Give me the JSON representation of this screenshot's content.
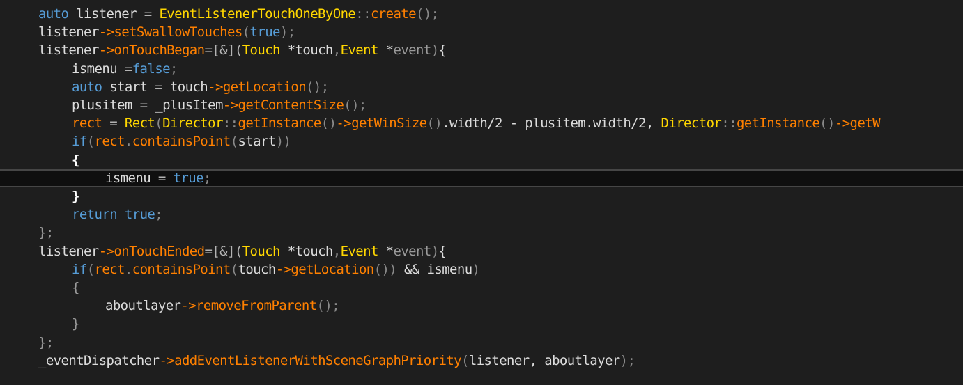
{
  "editor": {
    "theme": {
      "background": "#1e1e1e",
      "current_line_background": "#0f0f0f",
      "keyword_color": "#569cd6",
      "function_color": "#ff8000",
      "type_color": "#ffd700",
      "identifier_color": "#dcdcdc",
      "punctuation_color": "#8a8a8a"
    },
    "lines": [
      {
        "indent": 1,
        "tokens": [
          [
            "kw",
            "auto"
          ],
          [
            "id",
            " listener "
          ],
          [
            "op",
            "="
          ],
          [
            "id",
            " "
          ],
          [
            "type",
            "EventListenerTouchOneByOne"
          ],
          [
            "punc",
            "::"
          ],
          [
            "fn",
            "create"
          ],
          [
            "punc",
            "();"
          ]
        ]
      },
      {
        "indent": 1,
        "tokens": [
          [
            "id",
            "listener"
          ],
          [
            "fn",
            "->"
          ],
          [
            "fn",
            "setSwallowTouches"
          ],
          [
            "punc",
            "("
          ],
          [
            "kw",
            "true"
          ],
          [
            "punc",
            ");"
          ]
        ]
      },
      {
        "indent": 1,
        "tokens": [
          [
            "id",
            "listener"
          ],
          [
            "fn",
            "->"
          ],
          [
            "fn",
            "onTouchBegan"
          ],
          [
            "op",
            "=[&]("
          ],
          [
            "type",
            "Touch"
          ],
          [
            "id",
            " *touch"
          ],
          [
            "punc",
            ","
          ],
          [
            "type",
            "Event"
          ],
          [
            "id",
            " *"
          ],
          [
            "param",
            "event"
          ],
          [
            "punc",
            ")"
          ],
          [
            "brace",
            "{"
          ]
        ]
      },
      {
        "indent": 2,
        "tokens": [
          [
            "id",
            "ismenu "
          ],
          [
            "op",
            "="
          ],
          [
            "kw",
            "false"
          ],
          [
            "punc",
            ";"
          ]
        ]
      },
      {
        "indent": 2,
        "tokens": [
          [
            "kw",
            "auto"
          ],
          [
            "id",
            " start "
          ],
          [
            "op",
            "="
          ],
          [
            "id",
            " touch"
          ],
          [
            "fn",
            "->"
          ],
          [
            "fn",
            "getLocation"
          ],
          [
            "punc",
            "();"
          ]
        ]
      },
      {
        "indent": 2,
        "tokens": [
          [
            "id",
            "plusitem "
          ],
          [
            "op",
            "="
          ],
          [
            "id",
            " _plusItem"
          ],
          [
            "fn",
            "->"
          ],
          [
            "fn",
            "getContentSize"
          ],
          [
            "punc",
            "();"
          ]
        ]
      },
      {
        "indent": 2,
        "tokens": [
          [
            "fn",
            "rect"
          ],
          [
            "id",
            " "
          ],
          [
            "op",
            "="
          ],
          [
            "id",
            " "
          ],
          [
            "type",
            "Rect"
          ],
          [
            "punc",
            "("
          ],
          [
            "type",
            "Director"
          ],
          [
            "punc",
            "::"
          ],
          [
            "fn",
            "getInstance"
          ],
          [
            "punc",
            "()"
          ],
          [
            "fn",
            "->"
          ],
          [
            "fn",
            "getWinSize"
          ],
          [
            "punc",
            "()"
          ],
          [
            "id",
            ".width/2 - plusitem.width/2, "
          ],
          [
            "type",
            "Director"
          ],
          [
            "punc",
            "::"
          ],
          [
            "fn",
            "getInstance"
          ],
          [
            "punc",
            "()"
          ],
          [
            "fn",
            "->"
          ],
          [
            "fn",
            "getW"
          ]
        ]
      },
      {
        "indent": 2,
        "tokens": [
          [
            "kw",
            "if"
          ],
          [
            "punc",
            "("
          ],
          [
            "fn",
            "rect"
          ],
          [
            "punc",
            "."
          ],
          [
            "fn",
            "containsPoint"
          ],
          [
            "punc",
            "("
          ],
          [
            "id",
            "start"
          ],
          [
            "punc",
            "))"
          ]
        ]
      },
      {
        "indent": 2,
        "tokens": [
          [
            "bold",
            "{"
          ]
        ]
      },
      {
        "indent": 3,
        "current": true,
        "tokens": [
          [
            "id",
            "ismenu "
          ],
          [
            "op",
            "="
          ],
          [
            "id",
            " "
          ],
          [
            "kw",
            "true"
          ],
          [
            "punc",
            ";"
          ]
        ]
      },
      {
        "indent": 2,
        "tokens": [
          [
            "bold",
            "}"
          ]
        ]
      },
      {
        "indent": 2,
        "tokens": [
          [
            "kw",
            "return"
          ],
          [
            "id",
            " "
          ],
          [
            "kw",
            "true"
          ],
          [
            "punc",
            ";"
          ]
        ]
      },
      {
        "indent": 1,
        "tokens": [
          [
            "dim",
            "};"
          ]
        ]
      },
      {
        "indent": 1,
        "tokens": [
          [
            "id",
            "listener"
          ],
          [
            "fn",
            "->"
          ],
          [
            "fn",
            "onTouchEnded"
          ],
          [
            "op",
            "=[&]("
          ],
          [
            "type",
            "Touch"
          ],
          [
            "id",
            " *touch"
          ],
          [
            "punc",
            ","
          ],
          [
            "type",
            "Event"
          ],
          [
            "id",
            " *"
          ],
          [
            "param",
            "event"
          ],
          [
            "punc",
            ")"
          ],
          [
            "brace",
            "{"
          ]
        ]
      },
      {
        "indent": 2,
        "tokens": [
          [
            "kw",
            "if"
          ],
          [
            "punc",
            "("
          ],
          [
            "fn",
            "rect"
          ],
          [
            "punc",
            "."
          ],
          [
            "fn",
            "containsPoint"
          ],
          [
            "punc",
            "("
          ],
          [
            "id",
            "touch"
          ],
          [
            "fn",
            "->"
          ],
          [
            "fn",
            "getLocation"
          ],
          [
            "punc",
            "())"
          ],
          [
            "id",
            " && ismenu"
          ],
          [
            "punc",
            ")"
          ]
        ]
      },
      {
        "indent": 2,
        "tokens": [
          [
            "dim",
            "{"
          ]
        ]
      },
      {
        "indent": 3,
        "tokens": [
          [
            "id",
            "aboutlayer"
          ],
          [
            "fn",
            "->"
          ],
          [
            "fn",
            "removeFromParent"
          ],
          [
            "punc",
            "();"
          ]
        ]
      },
      {
        "indent": 2,
        "tokens": [
          [
            "dim",
            "}"
          ]
        ]
      },
      {
        "indent": 1,
        "tokens": [
          [
            "dim",
            "};"
          ]
        ]
      },
      {
        "indent": 1,
        "tokens": [
          [
            "id",
            "_eventDispatcher"
          ],
          [
            "fn",
            "->"
          ],
          [
            "fn",
            "addEventListenerWithSceneGraphPriority"
          ],
          [
            "punc",
            "("
          ],
          [
            "id",
            "listener, aboutlayer"
          ],
          [
            "punc",
            ");"
          ]
        ]
      }
    ]
  }
}
